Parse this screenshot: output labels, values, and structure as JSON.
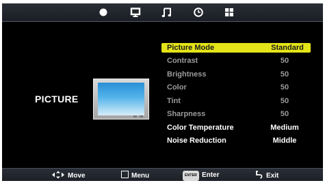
{
  "topbar": {
    "icons": [
      "picture-dot-icon",
      "monitor-icon",
      "music-note-icon",
      "clock-icon",
      "grid-icon"
    ]
  },
  "side": {
    "title": "PICTURE",
    "preview_icon": "tv-icon"
  },
  "menu": {
    "items": [
      {
        "label": "Picture Mode",
        "value": "Standard"
      },
      {
        "label": "Contrast",
        "value": "50"
      },
      {
        "label": "Brightness",
        "value": "50"
      },
      {
        "label": "Color",
        "value": "50"
      },
      {
        "label": "Tint",
        "value": "50"
      },
      {
        "label": "Sharpness",
        "value": "50"
      },
      {
        "label": "Color Temperature",
        "value": "Medium"
      },
      {
        "label": "Noise Reduction",
        "value": "Middle"
      }
    ]
  },
  "hints": {
    "move": "Move",
    "menu": "Menu",
    "enter_key": "ENTER",
    "enter": "Enter",
    "exit": "Exit"
  },
  "colors": {
    "highlight": "#e4e418",
    "dim_text": "#9b9b9b",
    "bar": "#2a2e36"
  }
}
